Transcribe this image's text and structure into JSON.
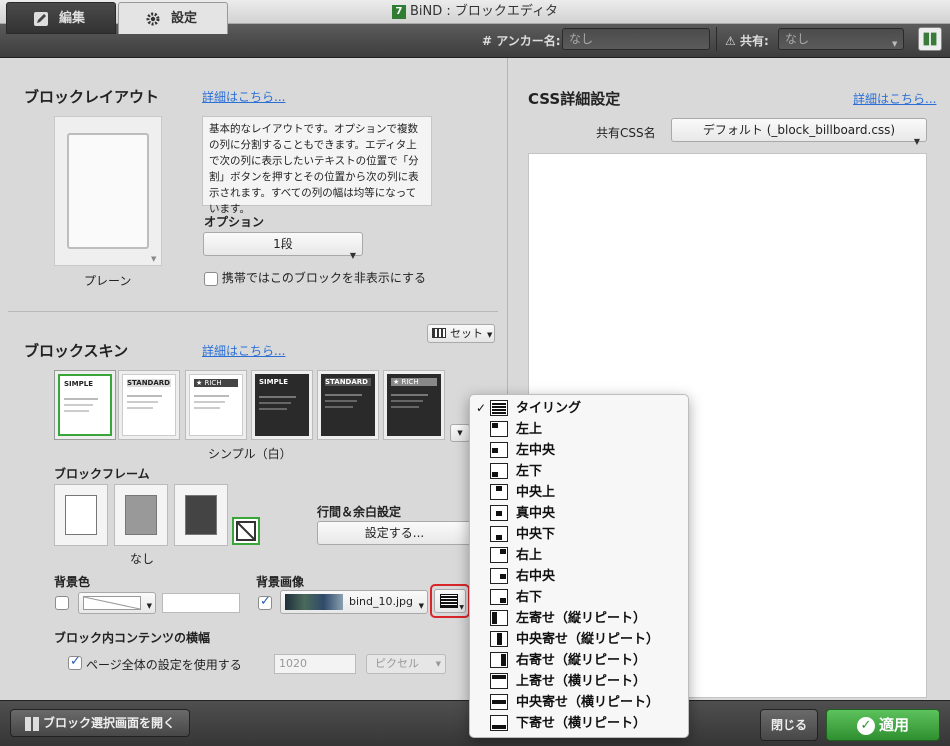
{
  "window": {
    "title": "BiND : ブロックエディタ",
    "app_icon": "7"
  },
  "toolbar": {
    "tab_edit": "編集",
    "tab_settings": "設定",
    "anchor_label": "# アンカー名:",
    "anchor_placeholder": "なし",
    "share_label": "共有:",
    "share_value": "なし"
  },
  "layout_section": {
    "title": "ブロックレイアウト",
    "detail_link": "詳細はこちら...",
    "preview_label": "プレーン",
    "description": "基本的なレイアウトです。オプションで複数の列に分割することもできます。エディタ上で次の列に表示したいテキストの位置で「分割」ボタンを押すとその位置から次の列に表示されます。すべての列の幅は均等になっています。",
    "options_label": "オプション",
    "options_value": "1段",
    "hide_mobile_label": "携帯ではこのブロックを非表示にする"
  },
  "skin_section": {
    "title": "ブロックスキン",
    "detail_link": "詳細はこちら...",
    "set_button": "セット",
    "skins": [
      {
        "tag": "SIMPLE",
        "dark": false,
        "selected": true
      },
      {
        "tag": "STANDARD",
        "dark": false,
        "selected": false
      },
      {
        "tag": "★ RICH",
        "dark": false,
        "selected": false
      },
      {
        "tag": "SIMPLE",
        "dark": true,
        "selected": false
      },
      {
        "tag": "STANDARD",
        "dark": true,
        "selected": false
      },
      {
        "tag": "★ RICH",
        "dark": true,
        "selected": false
      }
    ],
    "selected_skin_name": "シンプル（白）",
    "frame_label": "ブロックフレーム",
    "frame_name": "なし",
    "spacing_label": "行間＆余白設定",
    "spacing_button": "設定する...",
    "bg_color_label": "背景色",
    "bg_image_label": "背景画像",
    "bg_image_file": "bind_10.jpg",
    "content_width_label": "ブロック内コンテンツの横幅",
    "use_page_setting_label": "ページ全体の設定を使用する",
    "width_value": "1020",
    "width_unit": "ピクセル"
  },
  "css_section": {
    "title": "CSS詳細設定",
    "detail_link": "詳細はこちら...",
    "shared_css_label": "共有CSS名",
    "shared_css_value": "デフォルト (_block_billboard.css)"
  },
  "bottom": {
    "block_select_button": "ブロック選択画面を開く",
    "close_button": "閉じる",
    "apply_button": "適用"
  },
  "tiling_menu": {
    "items": [
      {
        "label": "タイリング",
        "checked": true
      },
      {
        "label": "左上",
        "checked": false
      },
      {
        "label": "左中央",
        "checked": false
      },
      {
        "label": "左下",
        "checked": false
      },
      {
        "label": "中央上",
        "checked": false
      },
      {
        "label": "真中央",
        "checked": false
      },
      {
        "label": "中央下",
        "checked": false
      },
      {
        "label": "右上",
        "checked": false
      },
      {
        "label": "右中央",
        "checked": false
      },
      {
        "label": "右下",
        "checked": false
      },
      {
        "label": "左寄せ（縦リピート）",
        "checked": false
      },
      {
        "label": "中央寄せ（縦リピート）",
        "checked": false
      },
      {
        "label": "右寄せ（縦リピート）",
        "checked": false
      },
      {
        "label": "上寄せ（横リピート）",
        "checked": false
      },
      {
        "label": "中央寄せ（横リピート）",
        "checked": false
      },
      {
        "label": "下寄せ（横リピート）",
        "checked": false
      }
    ]
  },
  "colors": {
    "accent_green": "#3aa63a",
    "highlight_red": "#d9262b",
    "link_blue": "#2a6fd6"
  }
}
